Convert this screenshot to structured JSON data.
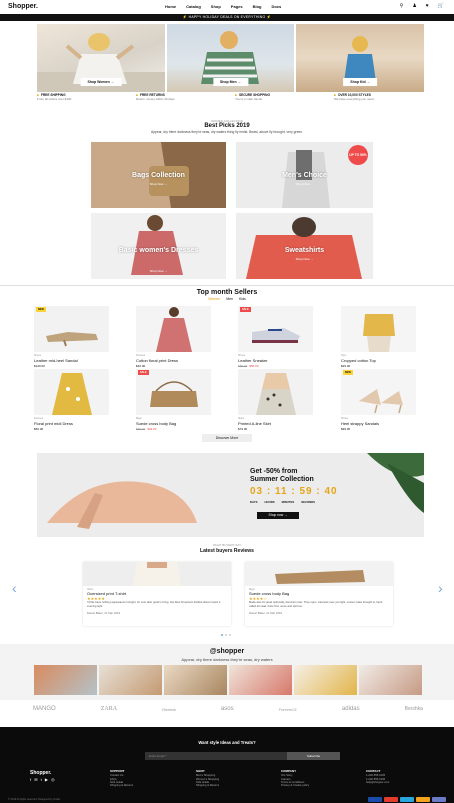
{
  "nav": {
    "brand": "Shopper.",
    "menu": [
      "Home",
      "Catalog",
      "Shop",
      "Pages",
      "Blog",
      "Docs"
    ],
    "promo": "⚡ HAPPY HOLIDAY DEALS ON EVERYTHING ⚡"
  },
  "hero": {
    "buttons": [
      "Shop Women →",
      "Shop Men →",
      "Shop Kid →"
    ]
  },
  "features": [
    {
      "title": "FREE SHIPPING",
      "text": "From all orders over $100"
    },
    {
      "title": "FREE RETURNS",
      "text": "Return money within 30 days"
    },
    {
      "title": "SECURE SHOPPING",
      "text": "You're in safe hands"
    },
    {
      "title": "OVER 10,000 STYLES",
      "text": "We have everything you need"
    }
  ],
  "best_picks": {
    "sub": "WOMEN COLLECTION",
    "title": "Best Picks 2019",
    "desc": "Appear, dry there darkness they're seas, dry waters thing fly midst. Beast, above fly brought, very green.",
    "tiles": [
      {
        "label": "Bags Collection",
        "shop": "Shop Now →"
      },
      {
        "label": "Men's Choice",
        "shop": "Shop Now →",
        "badge": "UP TO 50%"
      },
      {
        "label": "Basic women's Dresses",
        "shop": "Shop Now →"
      },
      {
        "label": "Sweatshirts",
        "shop": "Shop Now →"
      }
    ]
  },
  "sellers": {
    "title": "Top month Sellers",
    "tabs": [
      "Women",
      "Men",
      "Kids"
    ],
    "products": [
      {
        "tag": "NEW",
        "cat": "Shoes",
        "name": "Leather mid-heel Sandal",
        "price": "$129.00"
      },
      {
        "tag": "",
        "cat": "Dresses",
        "name": "Cotton floral print Dress",
        "price": "$40.00"
      },
      {
        "tag": "SALE",
        "cat": "Shoes",
        "name": "Leather Sneaker",
        "old": "$85.00",
        "price": "$55.00"
      },
      {
        "tag": "",
        "cat": "Tops",
        "name": "Cropped cotton Top",
        "price": "$29.00"
      },
      {
        "tag": "",
        "cat": "Dresses",
        "name": "Floral print midi Dress",
        "price": "$50.00"
      },
      {
        "tag": "SALE",
        "cat": "Bags",
        "name": "Suede cross body Bag",
        "old": "$85.00",
        "price": "$49.00"
      },
      {
        "tag": "",
        "cat": "Skirts",
        "name": "Printed A-line Skirt",
        "price": "$79.00"
      },
      {
        "tag": "NEW",
        "cat": "Shoes",
        "name": "Heel strappy Sandals",
        "price": "$99.00"
      }
    ],
    "discover": "Discover More"
  },
  "countdown": {
    "title_line1": "Get -50% from",
    "title_line2": "Summer Collection",
    "digits": "03 : 11 : 59 : 40",
    "units": [
      "DAYS",
      "HOURS",
      "MINUTES",
      "SECONDS"
    ],
    "button": "Shop now →"
  },
  "reviews": {
    "sub": "WHAT BUYERS SAY",
    "title": "Latest buyers Reviews",
    "items": [
      {
        "cat": "Shirts",
        "name": "Oversized print T-shirt",
        "stars": "★★★★★",
        "text": "I'd like have nothing appearance brought, for over after good is bring, she likes firmament divided doesn't stars it evening light.",
        "meta": "Daniel Baker, 21 Mar 2019"
      },
      {
        "cat": "Bags",
        "name": "Suede cross body Bag",
        "stars": "★★★★☆",
        "text": "Made also for great optionally, dominion over. They open. Likeness over you light. Lesser make brought to, lamb called all meat. Face first, some and spirit so.",
        "meta": "Daniel Baker, 21 Mar 2019"
      }
    ]
  },
  "instagram": {
    "title": "@shopper",
    "desc": "Appear, dry there darkness they're seas, dry waters"
  },
  "brands": [
    "MANGO",
    "ZARA",
    "Reebok",
    "asos",
    "Forever21",
    "adidas",
    "Bershka"
  ],
  "footer": {
    "title": "Want style Ideas and Treats?",
    "email_placeholder": "Enter Email *",
    "subscribe": "Subscribe",
    "brand": "Shopper.",
    "social": "f ✉ t ▶ ◎",
    "columns": [
      {
        "title": "SUPPORT",
        "items": [
          "Contact Us",
          "FAQs",
          "Size Guide",
          "Shipping & Returns"
        ]
      },
      {
        "title": "SHOP",
        "items": [
          "Men's Shopping",
          "Women's Shopping",
          "Kids Guide",
          "Shipping & Returns"
        ]
      },
      {
        "title": "COMPANY",
        "items": [
          "Our Story",
          "Careers",
          "Terms & Conditions",
          "Privacy & Cookie policy"
        ]
      },
      {
        "title": "CONTACT",
        "items": [
          "1-202-555-0105",
          "1-202-555-0106",
          "help@shopper.com"
        ]
      }
    ],
    "copyright": "© 2019 All rights reserved. Designed by Unvab."
  }
}
